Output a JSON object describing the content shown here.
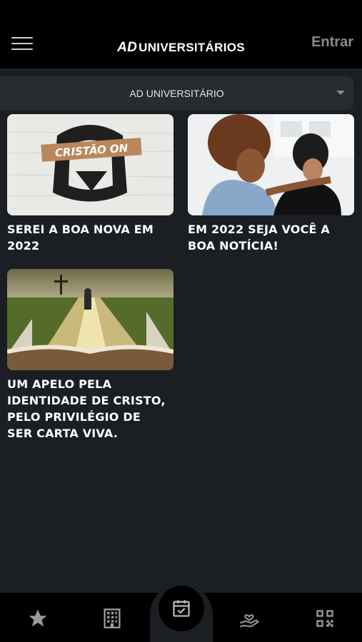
{
  "header": {
    "logo_ad": "AD",
    "logo_text": "UNIVERSITÁRIOS",
    "login_label": "Entrar"
  },
  "selector": {
    "value": "AD UNIVERSITÁRIO"
  },
  "cards": [
    {
      "title": "SEREI A BOA NOVA EM\n2022",
      "image": "cristao-on-graphic"
    },
    {
      "title": "EM 2022 SEJA VOCÊ A\nBOA NOTÍCIA!",
      "image": "two-women-consoling-photo"
    },
    {
      "title": "UM APELO PELA\nIDENTIDADE DE CRISTO,\nPELO PRIVILÉGIO DE\nSER CARTA VIVA.",
      "image": "man-walking-on-bible-photo"
    }
  ],
  "tabbar": {
    "icons": [
      "star-icon",
      "building-icon",
      "calendar-check-icon",
      "hand-heart-icon",
      "qr-code-icon"
    ],
    "colors": {
      "icon": "#9a9a9a",
      "active": "#b5b5b5"
    }
  }
}
